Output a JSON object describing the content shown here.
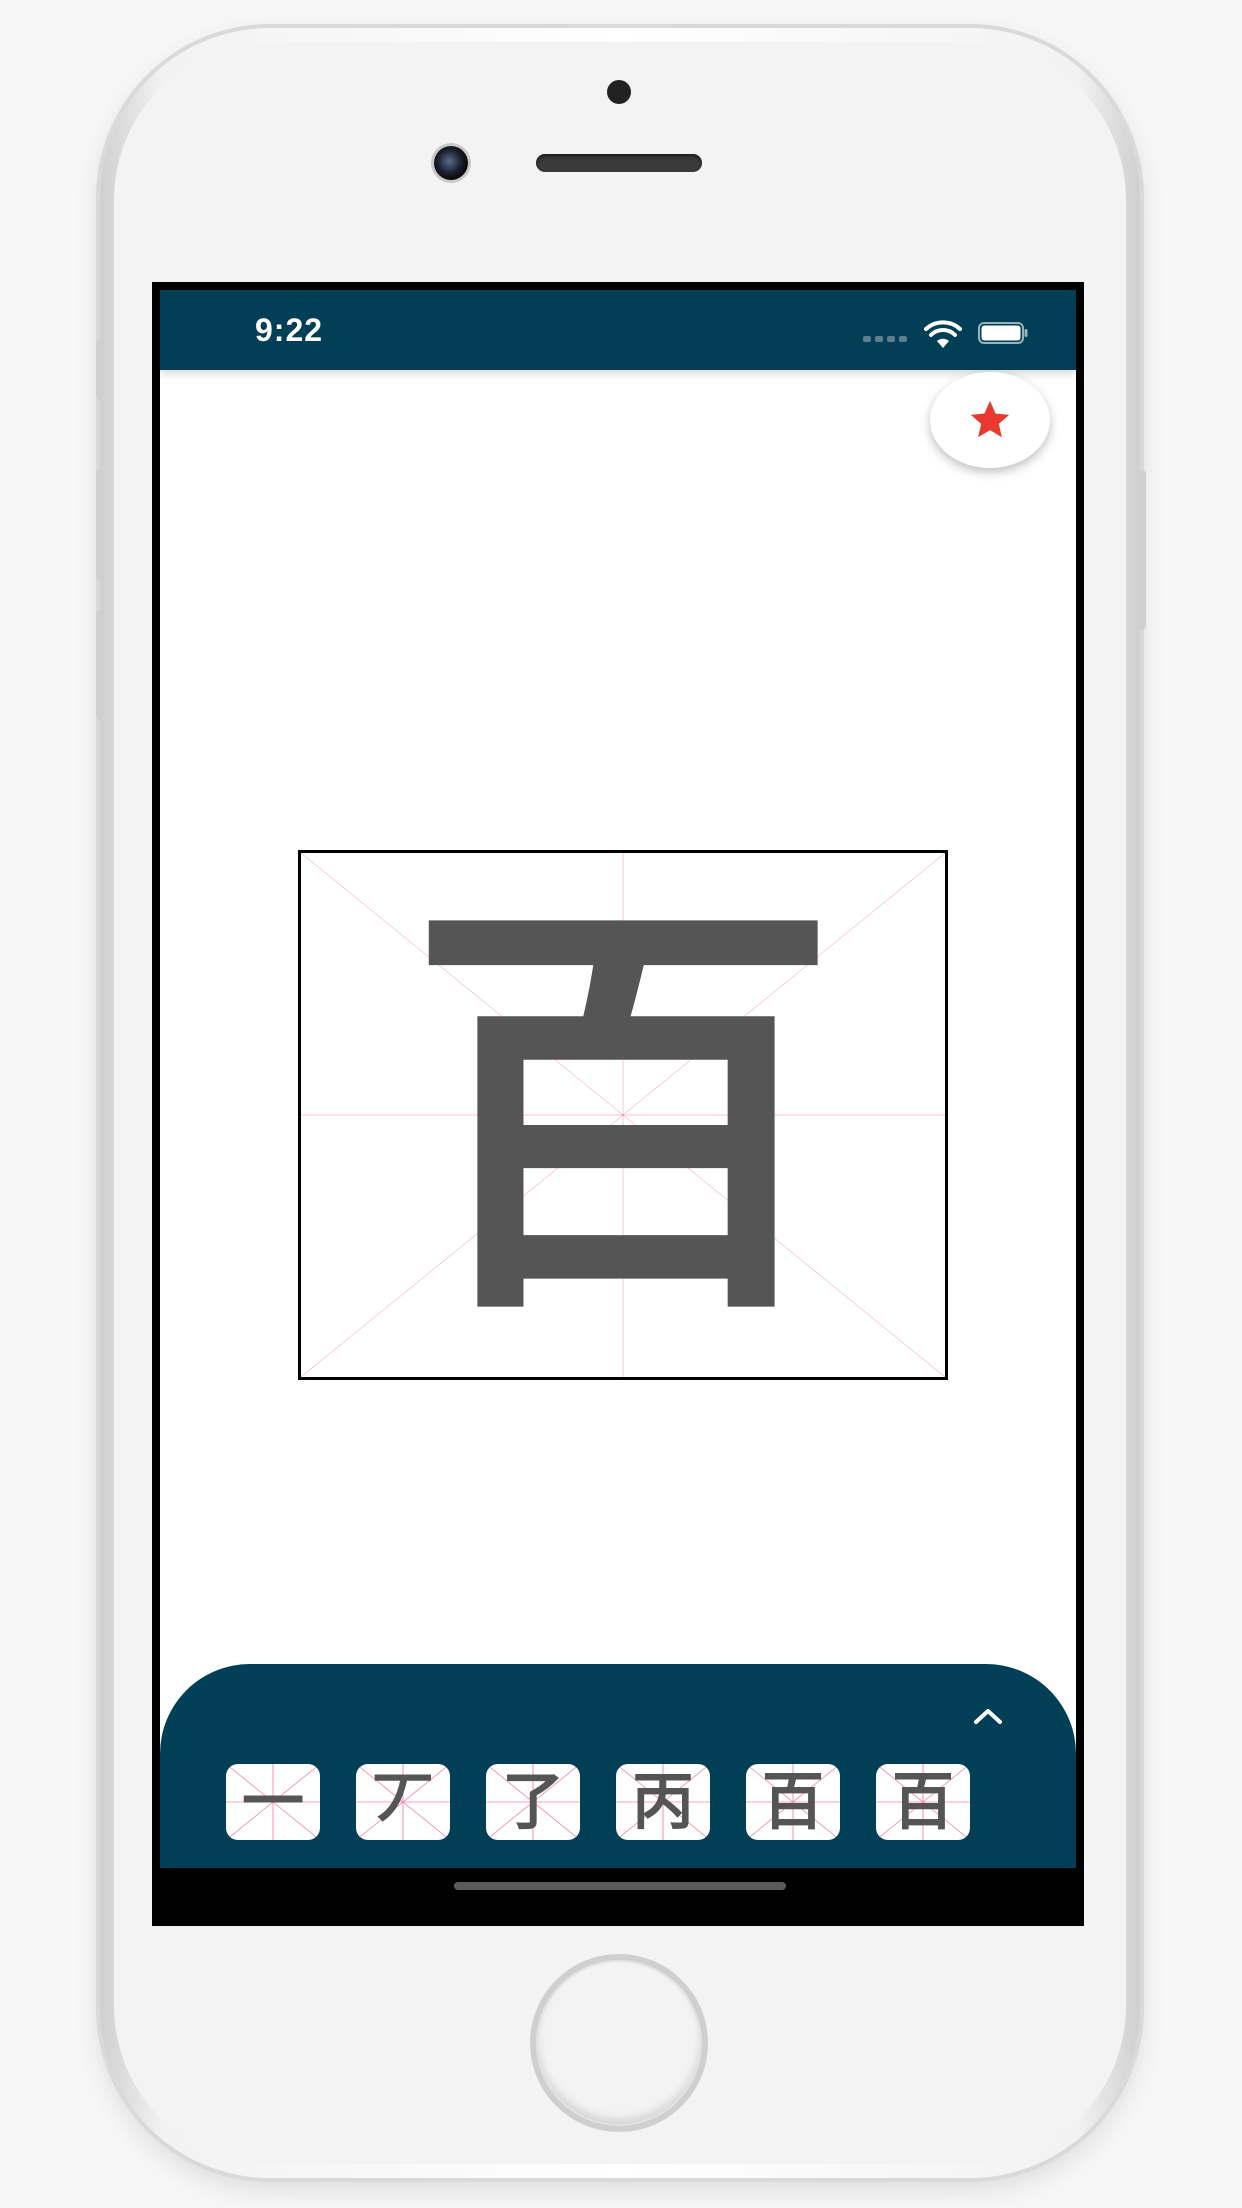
{
  "status_bar": {
    "time": "9:22"
  },
  "favorite": {
    "icon": "star-icon",
    "color": "#e8382f"
  },
  "character": {
    "glyph": "百"
  },
  "stroke_panel": {
    "toggle_icon": "chevron-up-icon",
    "steps": [
      "一",
      "丆",
      "了",
      "丙",
      "百",
      "百"
    ]
  },
  "colors": {
    "status_bar": "#003f56",
    "panel": "#003f56",
    "guide_lines": "#e0115f",
    "glyph": "#555555"
  }
}
